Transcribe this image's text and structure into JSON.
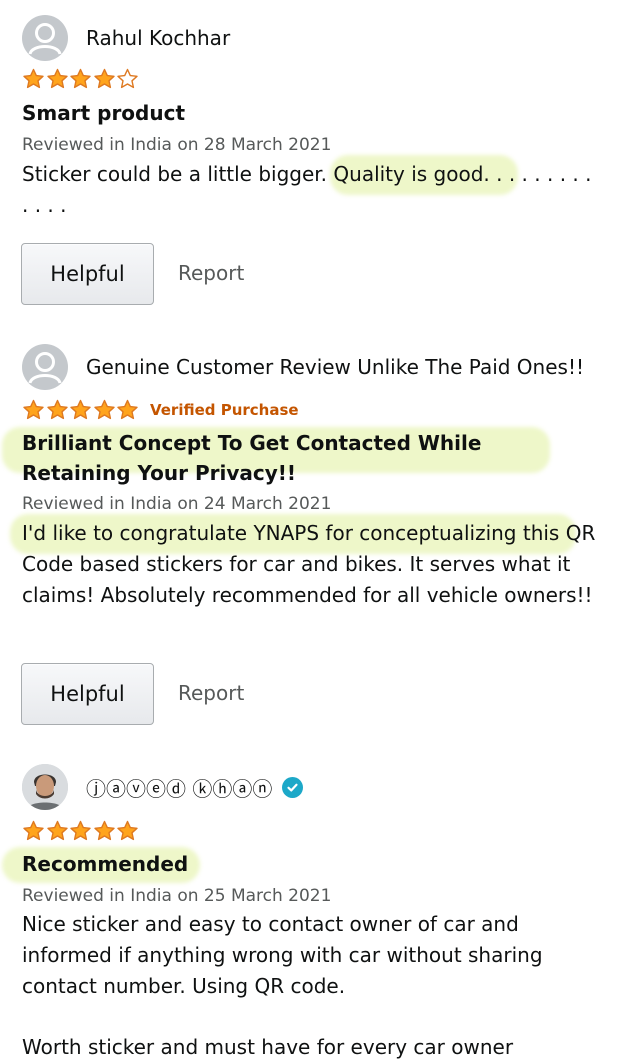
{
  "reviews": [
    {
      "reviewer": "Rahul Kochhar",
      "rating": 4,
      "verified": "",
      "title": "Smart product",
      "date": "Reviewed in India on 28 March 2021",
      "body": "Sticker could be a little bigger. Quality is good. . . . . . . . . . . . .",
      "helpful_label": "Helpful",
      "report_label": "Report"
    },
    {
      "reviewer": "Genuine Customer Review Unlike The Paid Ones!!",
      "rating": 5,
      "verified": "Verified Purchase",
      "title": "Brilliant Concept To Get Contacted While Retaining Your Privacy!!",
      "date": "Reviewed in India on 24 March 2021",
      "body": "I'd like to congratulate YNAPS for conceptualizing this QR Code based stickers for car and bikes. It serves what it claims! Absolutely recommended for all vehicle owners!!",
      "helpful_label": "Helpful",
      "report_label": "Report"
    },
    {
      "reviewer": "ⓙⓐⓥⓔⓓ ⓚⓗⓐⓝ",
      "rating": 5,
      "verified": "",
      "title": "Recommended",
      "date": "Reviewed in India on 25 March 2021",
      "body": "Nice sticker and easy to contact owner of car and informed if anything wrong with car without sharing contact number. Using QR code.",
      "body2": "Worth sticker and must have for every car owner"
    }
  ],
  "icons": {
    "avatar": "default-avatar-icon",
    "star": "star-icon",
    "badge": "verified-badge-icon"
  },
  "colors": {
    "star": "#ffa41c",
    "star_stroke": "#de7921",
    "verified": "#c45500",
    "highlight": "#eef7c9",
    "badge": "#1ca8c8"
  }
}
